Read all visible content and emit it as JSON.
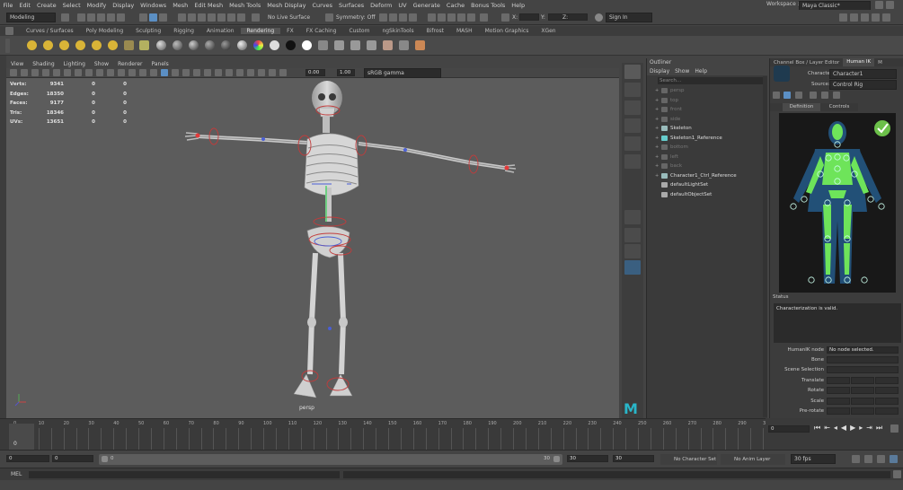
{
  "menus": [
    "File",
    "Edit",
    "Create",
    "Select",
    "Modify",
    "Display",
    "Windows",
    "Mesh",
    "Edit Mesh",
    "Mesh Tools",
    "Mesh Display",
    "Curves",
    "Surfaces",
    "Deform",
    "UV",
    "Generate",
    "Cache",
    "Bonus Tools",
    "Help"
  ],
  "workspace": {
    "label": "Workspace :",
    "value": "Maya Classic*"
  },
  "status": {
    "mode": "Modeling",
    "live_surface": "No Live Surface",
    "symmetry": "Symmetry: Off",
    "x_label": "X:",
    "y_label": "Y:",
    "z_label": "Z:",
    "sign_in": "Sign In"
  },
  "shelf_tabs": [
    "Curves / Surfaces",
    "Poly Modeling",
    "Sculpting",
    "Rigging",
    "Animation",
    "Rendering",
    "FX",
    "FX Caching",
    "Custom",
    "ngSkinTools",
    "Bifrost",
    "MASH",
    "Motion Graphics",
    "XGen"
  ],
  "shelf_active": "Rendering",
  "panel_menu": [
    "View",
    "Shading",
    "Lighting",
    "Show",
    "Renderer",
    "Panels"
  ],
  "panel_toolbar": {
    "exposure": "0.00",
    "gamma": "1.00",
    "color_space": "sRGB gamma"
  },
  "hud": [
    {
      "label": "Verts:",
      "v": "9341",
      "a": "0",
      "b": "0"
    },
    {
      "label": "Edges:",
      "v": "18350",
      "a": "0",
      "b": "0"
    },
    {
      "label": "Faces:",
      "v": "9177",
      "a": "0",
      "b": "0"
    },
    {
      "label": "Tris:",
      "v": "18346",
      "a": "0",
      "b": "0"
    },
    {
      "label": "UVs:",
      "v": "13651",
      "a": "0",
      "b": "0"
    }
  ],
  "camera_label": "persp",
  "outliner": {
    "title": "Outliner",
    "menu": [
      "Display",
      "Show",
      "Help"
    ],
    "search_placeholder": "Search...",
    "items": [
      {
        "name": "persp",
        "dim": true,
        "expand": "+",
        "color": "#666"
      },
      {
        "name": "top",
        "dim": true,
        "expand": "+",
        "color": "#666"
      },
      {
        "name": "front",
        "dim": true,
        "expand": "+",
        "color": "#666"
      },
      {
        "name": "side",
        "dim": true,
        "expand": "+",
        "color": "#666"
      },
      {
        "name": "Skeleton",
        "dim": false,
        "expand": "+",
        "color": "#9bb"
      },
      {
        "name": "Skeleton1_Reference",
        "dim": false,
        "expand": "+",
        "color": "#6cc"
      },
      {
        "name": "bottom",
        "dim": true,
        "expand": "+",
        "color": "#666"
      },
      {
        "name": "left",
        "dim": true,
        "expand": "+",
        "color": "#666"
      },
      {
        "name": "back",
        "dim": true,
        "expand": "+",
        "color": "#666"
      },
      {
        "name": "Character1_Ctrl_Reference",
        "dim": false,
        "expand": "+",
        "color": "#9bb"
      },
      {
        "name": "defaultLightSet",
        "dim": false,
        "expand": "",
        "color": "#aaa"
      },
      {
        "name": "defaultObjectSet",
        "dim": false,
        "expand": "",
        "color": "#aaa"
      }
    ]
  },
  "right_tabs": [
    "Channel Box / Layer Editor",
    "Human IK",
    "M"
  ],
  "right_tab_active": "Human IK",
  "hik": {
    "character_label": "Character:",
    "character_value": "Character1",
    "source_label": "Source:",
    "source_value": "Control Rig",
    "sub_tabs": [
      "Definition",
      "Controls"
    ],
    "sub_tab_active": "Definition",
    "status_label": "Status",
    "status_text": "Characterization is valid.",
    "node_label": "HumanIK node",
    "node_value": "No node selected.",
    "attrs": [
      "Bone",
      "Scene Selection",
      "Translate",
      "Rotate",
      "Scale",
      "Pre-rotate"
    ]
  },
  "timeline": {
    "ticks": [
      "0",
      "5",
      "10",
      "15",
      "20",
      "25",
      "30",
      "35",
      "40",
      "45",
      "50",
      "55",
      "60",
      "65",
      "70",
      "75",
      "80",
      "85",
      "90",
      "95",
      "100",
      "105",
      "110",
      "115",
      "120",
      "125",
      "130",
      "135",
      "140",
      "145",
      "150",
      "155",
      "160",
      "165",
      "170",
      "175",
      "180",
      "185",
      "190",
      "195",
      "200",
      "205",
      "210",
      "215",
      "220",
      "225",
      "230",
      "235",
      "240",
      "245",
      "250",
      "255",
      "260",
      "265",
      "270",
      "275",
      "280",
      "285",
      "290",
      "295",
      "300"
    ],
    "current_frame": "0",
    "playback_frame": "0"
  },
  "range": {
    "start": "0",
    "inner_start": "0",
    "slider_start": "0",
    "slider_end": "30",
    "inner_end": "30",
    "end": "30",
    "char_set": "No Character Set",
    "anim_layer": "No Anim Layer",
    "fps": "30 fps"
  },
  "cmd": {
    "label": "MEL"
  },
  "colors": {
    "accent_blue": "#5b8fc4",
    "hik_green": "#6ee45a",
    "hik_valid": "#6cc04a"
  }
}
